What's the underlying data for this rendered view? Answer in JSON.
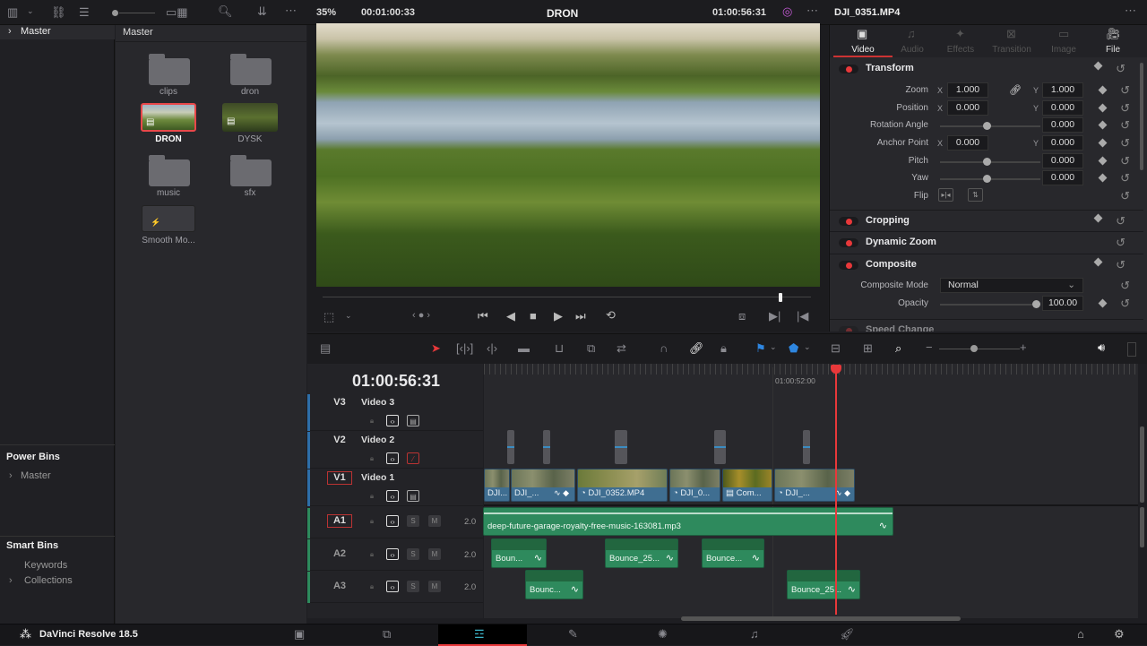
{
  "app": {
    "name": "DaVinci Resolve 18.5"
  },
  "topbar": {
    "zoom": "35%",
    "source_timecode": "00:01:00:33",
    "timeline_name": "DRON",
    "record_timecode": "01:00:56:31",
    "clip_name": "DJI_0351.MP4"
  },
  "media_pool": {
    "tree_master": "Master",
    "bin_header": "Master",
    "items": [
      {
        "name": "clips",
        "type": "folder"
      },
      {
        "name": "dron",
        "type": "folder"
      },
      {
        "name": "DRON",
        "type": "timeline",
        "selected": true
      },
      {
        "name": "DYSK",
        "type": "timeline"
      },
      {
        "name": "music",
        "type": "folder"
      },
      {
        "name": "sfx",
        "type": "folder"
      },
      {
        "name": "Smooth Mo...",
        "type": "clip"
      }
    ],
    "power_bins": {
      "title": "Power Bins",
      "items": [
        "Master"
      ]
    },
    "smart_bins": {
      "title": "Smart Bins",
      "items": [
        "Keywords",
        "Collections"
      ]
    }
  },
  "inspector": {
    "tabs": [
      {
        "label": "Video",
        "active": true
      },
      {
        "label": "Audio"
      },
      {
        "label": "Effects"
      },
      {
        "label": "Transition"
      },
      {
        "label": "Image"
      },
      {
        "label": "File"
      }
    ],
    "transform": {
      "title": "Transform",
      "zoom_label": "Zoom",
      "zoom_x": "1.000",
      "zoom_y": "1.000",
      "position_label": "Position",
      "position_x": "0.000",
      "position_y": "0.000",
      "rotation_label": "Rotation Angle",
      "rotation": "0.000",
      "anchor_label": "Anchor Point",
      "anchor_x": "0.000",
      "anchor_y": "0.000",
      "pitch_label": "Pitch",
      "pitch": "0.000",
      "yaw_label": "Yaw",
      "yaw": "0.000",
      "flip_label": "Flip",
      "x": "X",
      "y": "Y"
    },
    "cropping": "Cropping",
    "dynamic_zoom": "Dynamic Zoom",
    "composite": {
      "title": "Composite",
      "mode_label": "Composite Mode",
      "mode": "Normal",
      "opacity_label": "Opacity",
      "opacity": "100.00"
    },
    "speed_change": "Speed Change"
  },
  "timeline": {
    "timecode": "01:00:56:31",
    "ruler_mark": "01:00:52:00",
    "video_tracks": [
      {
        "id": "V3",
        "name": "Video 3"
      },
      {
        "id": "V2",
        "name": "Video 2"
      },
      {
        "id": "V1",
        "name": "Video 1"
      }
    ],
    "audio_tracks": [
      {
        "id": "A1",
        "level": "2.0"
      },
      {
        "id": "A2",
        "level": "2.0"
      },
      {
        "id": "A3",
        "level": "2.0"
      }
    ],
    "solo": "S",
    "mute": "M",
    "v1_clips": [
      "DJI...",
      "DJI_...",
      "DJI_0352.MP4",
      "DJI_0...",
      "Com...",
      "DJI_..."
    ],
    "a1_clip": "deep-future-garage-royalty-free-music-163081.mp3",
    "a2_clips": [
      "Boun...",
      "Bounce_25...",
      "Bounce..."
    ],
    "a3_clips": [
      "Bounc...",
      "Bounce_25..."
    ]
  }
}
